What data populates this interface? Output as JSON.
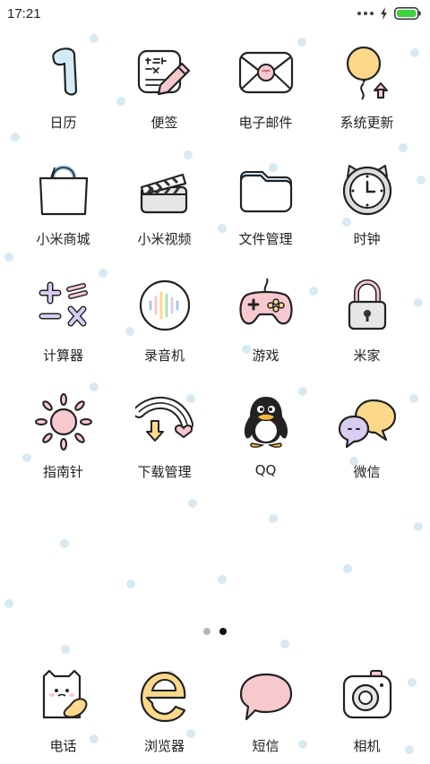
{
  "status_bar": {
    "time": "17:21",
    "battery_color": "#3fd23f"
  },
  "apps": [
    {
      "label": "日历",
      "icon": "calendar-icon"
    },
    {
      "label": "便签",
      "icon": "notes-icon"
    },
    {
      "label": "电子邮件",
      "icon": "email-icon"
    },
    {
      "label": "系统更新",
      "icon": "system-update-icon"
    },
    {
      "label": "小米商城",
      "icon": "mi-store-icon"
    },
    {
      "label": "小米视频",
      "icon": "mi-video-icon"
    },
    {
      "label": "文件管理",
      "icon": "file-manager-icon"
    },
    {
      "label": "时钟",
      "icon": "clock-icon"
    },
    {
      "label": "计算器",
      "icon": "calculator-icon"
    },
    {
      "label": "录音机",
      "icon": "recorder-icon"
    },
    {
      "label": "游戏",
      "icon": "game-controller-icon"
    },
    {
      "label": "米家",
      "icon": "mijia-lock-icon"
    },
    {
      "label": "指南针",
      "icon": "compass-sun-icon"
    },
    {
      "label": "下载管理",
      "icon": "download-manager-icon"
    },
    {
      "label": "QQ",
      "icon": "qq-penguin-icon"
    },
    {
      "label": "微信",
      "icon": "wechat-icon"
    }
  ],
  "page_indicator": {
    "pages": 2,
    "current": 2
  },
  "dock": [
    {
      "label": "电话",
      "icon": "phone-icon"
    },
    {
      "label": "浏览器",
      "icon": "browser-icon"
    },
    {
      "label": "短信",
      "icon": "messages-icon"
    },
    {
      "label": "相机",
      "icon": "camera-icon"
    }
  ],
  "colors": {
    "background": "#ffffff",
    "dot": "#d7e9f2",
    "outline": "#222222",
    "pink": "#f7c9cf",
    "blue": "#d3ebf7",
    "yellow": "#fcd98a",
    "grey": "#e6e6e6"
  }
}
